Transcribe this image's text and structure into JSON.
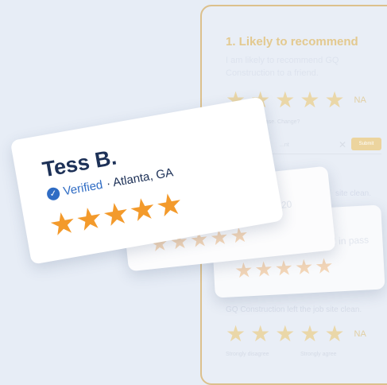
{
  "survey": {
    "question1_title": "1. Likely to recommend",
    "question1_text": "I am likely to recommend GQ Construction to a friend.",
    "rating_star": "★",
    "na_label": "NA",
    "feedback_hint": "...ase. Change?",
    "input_placeholder": "...nt",
    "clear_icon": "✕",
    "submit_label": "Submit",
    "partial_text_1": "site clean.",
    "question2_text": "GQ Construction left the job site clean.",
    "scale_low": "Strongly disagree",
    "scale_high": "Strongly agree"
  },
  "review_cards": {
    "back_card": {
      "partial_text": "...ll in pass"
    },
    "middle_card": {
      "partial_date": "5 2020"
    },
    "front_card": {
      "reviewer_name": "Tess B.",
      "verified_label": "Verified",
      "location": "· Atlanta, GA",
      "rating": 5,
      "star": "★"
    }
  },
  "colors": {
    "background": "#e7edf6",
    "accent_gold": "#dcc08c",
    "star_orange": "#f39a2b",
    "navy": "#1d3157",
    "verified_blue": "#2f6cc4"
  }
}
